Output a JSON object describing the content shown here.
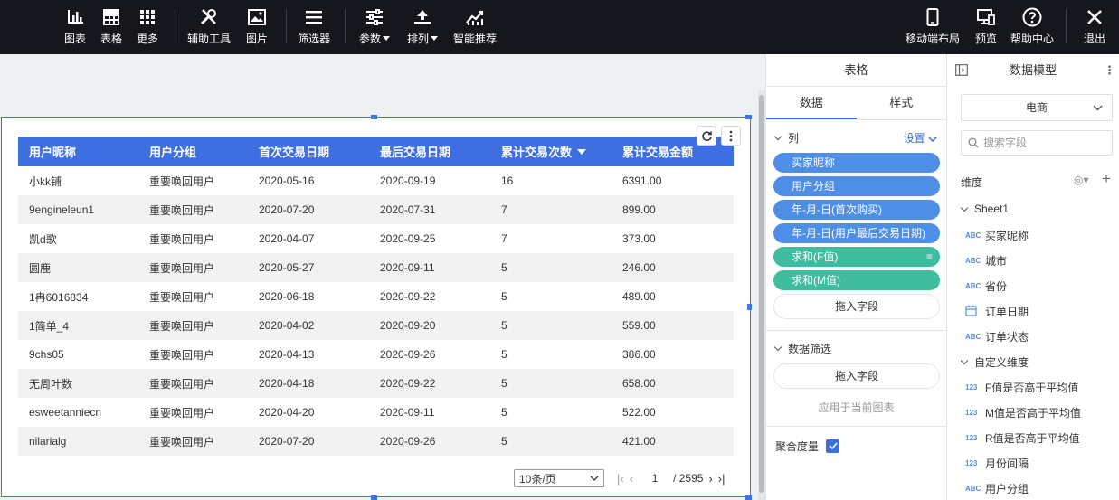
{
  "toolbar": {
    "left": [
      {
        "label": "图表",
        "icon": "bar-chart-icon"
      },
      {
        "label": "表格",
        "icon": "table-icon"
      },
      {
        "label": "更多",
        "icon": "grid-icon"
      },
      {
        "label": "辅助工具",
        "icon": "tools-icon"
      },
      {
        "label": "图片",
        "icon": "image-icon"
      },
      {
        "label": "筛选器",
        "icon": "filter-icon"
      },
      {
        "label": "参数",
        "icon": "sliders-icon"
      },
      {
        "label": "排列",
        "icon": "arrange-icon"
      },
      {
        "label": "智能推荐",
        "icon": "smart-chart-icon"
      }
    ],
    "right": [
      {
        "label": "移动端布局",
        "icon": "mobile-icon"
      },
      {
        "label": "预览",
        "icon": "preview-icon"
      },
      {
        "label": "帮助中心",
        "icon": "help-icon"
      },
      {
        "label": "退出",
        "icon": "close-icon"
      }
    ]
  },
  "table": {
    "headers": [
      "用户昵称",
      "用户分组",
      "首次交易日期",
      "最后交易日期",
      "累计交易次数",
      "累计交易金额"
    ],
    "rows": [
      [
        "小kk铺",
        "重要唤回用户",
        "2020-05-16",
        "2020-09-19",
        "16",
        "6391.00"
      ],
      [
        "9engineleun1",
        "重要唤回用户",
        "2020-07-20",
        "2020-07-31",
        "7",
        "899.00"
      ],
      [
        "凯d歌",
        "重要唤回用户",
        "2020-04-07",
        "2020-09-25",
        "7",
        "373.00"
      ],
      [
        "圆鹿",
        "重要唤回用户",
        "2020-05-27",
        "2020-09-11",
        "5",
        "246.00"
      ],
      [
        "1冉6016834",
        "重要唤回用户",
        "2020-06-18",
        "2020-09-22",
        "5",
        "489.00"
      ],
      [
        "1简单_4",
        "重要唤回用户",
        "2020-04-02",
        "2020-09-20",
        "5",
        "559.00"
      ],
      [
        "9chs05",
        "重要唤回用户",
        "2020-04-13",
        "2020-09-26",
        "5",
        "386.00"
      ],
      [
        "无周叶数",
        "重要唤回用户",
        "2020-04-18",
        "2020-09-22",
        "5",
        "658.00"
      ],
      [
        "esweetanniecn",
        "重要唤回用户",
        "2020-04-20",
        "2020-09-11",
        "5",
        "522.00"
      ],
      [
        "nilarialg",
        "重要唤回用户",
        "2020-07-20",
        "2020-09-26",
        "5",
        "421.00"
      ]
    ],
    "pagination": {
      "page_size": "10条/页",
      "current": "1",
      "total": "/ 2595"
    }
  },
  "mid_panel": {
    "title": "表格",
    "tabs": [
      "数据",
      "样式"
    ],
    "columns_label": "列",
    "settings_label": "设置",
    "fields": [
      {
        "label": "买家昵称",
        "kind": "blue"
      },
      {
        "label": "用户分组",
        "kind": "blue"
      },
      {
        "label": "年-月-日(首次购买)",
        "kind": "blue"
      },
      {
        "label": "年-月-日(用户最后交易日期)",
        "kind": "blue"
      },
      {
        "label": "求和(F值)",
        "kind": "green"
      },
      {
        "label": "求和(M值)",
        "kind": "green"
      }
    ],
    "drop_label": "拖入字段",
    "filter_label": "数据筛选",
    "filter_drop_label": "拖入字段",
    "apply_label": "应用于当前图表",
    "aggregate_label": "聚合度量"
  },
  "right_panel": {
    "title": "数据模型",
    "dataset": "电商",
    "search_placeholder": "搜索字段",
    "dimension_label": "维度",
    "sheet": "Sheet1",
    "sheet_fields": [
      {
        "type": "ABC",
        "label": "买家昵称"
      },
      {
        "type": "ABC",
        "label": "城市"
      },
      {
        "type": "ABC",
        "label": "省份"
      },
      {
        "type": "date",
        "label": "订单日期"
      },
      {
        "type": "ABC",
        "label": "订单状态"
      }
    ],
    "custom_group": "自定义维度",
    "custom_fields": [
      {
        "type": "123",
        "label": "F值是否高于平均值"
      },
      {
        "type": "123",
        "label": "M值是否高于平均值"
      },
      {
        "type": "123",
        "label": "R值是否高于平均值"
      },
      {
        "type": "123",
        "label": "月份间隔"
      },
      {
        "type": "ABC",
        "label": "用户分组"
      }
    ]
  },
  "colors": {
    "accent": "#3d6fe0",
    "toolbar_bg": "#15171c",
    "pill_blue": "#4f8ee6",
    "pill_green": "#3ebd9e"
  }
}
